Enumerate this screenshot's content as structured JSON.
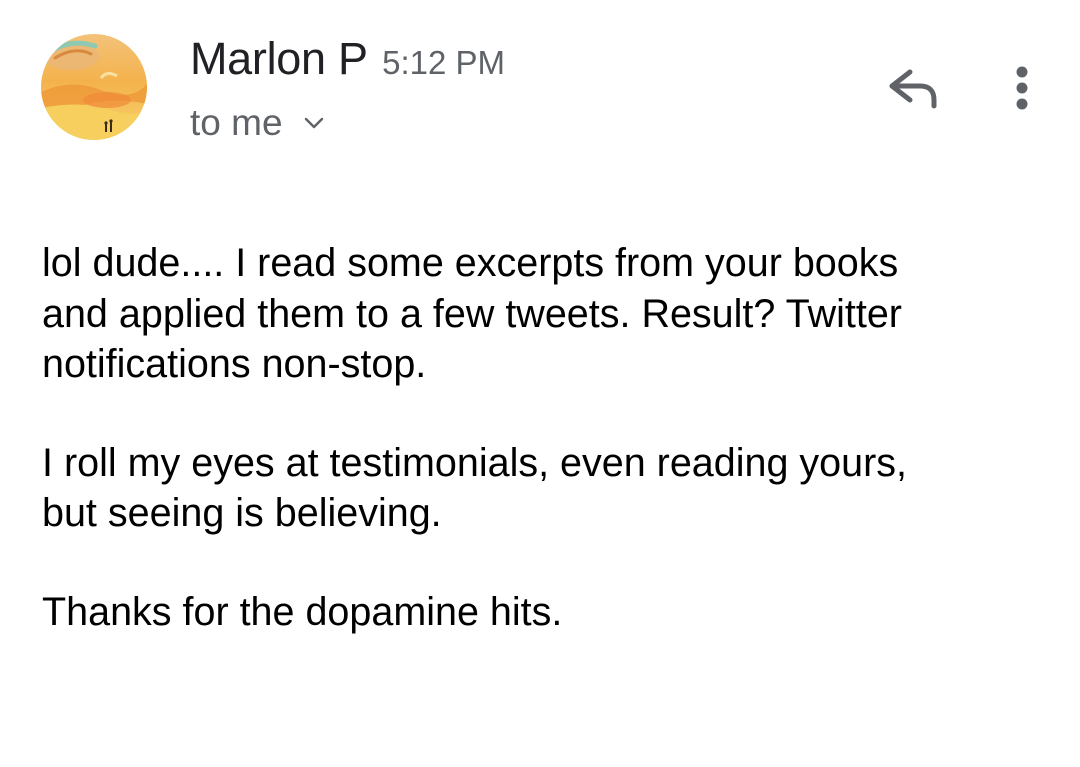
{
  "email": {
    "sender_name": "Marlon P",
    "time": "5:12 PM",
    "recipient": "to me",
    "avatar_icon": "sunset-landscape-avatar",
    "icons": {
      "expand": "chevron-down-icon",
      "reply": "reply-arrow-icon",
      "more": "more-vertical-icon"
    },
    "body": [
      "lol dude.... I read some excerpts from your books\nand applied them to a few tweets. Result? Twitter\nnotifications non-stop.",
      "I roll my eyes at testimonials, even reading yours,\nbut seeing is believing.",
      "Thanks for the dopamine hits."
    ]
  },
  "colors": {
    "primary_text": "#202124",
    "secondary_text": "#5f6368",
    "body_text": "#000000",
    "icon": "#5f6368"
  }
}
